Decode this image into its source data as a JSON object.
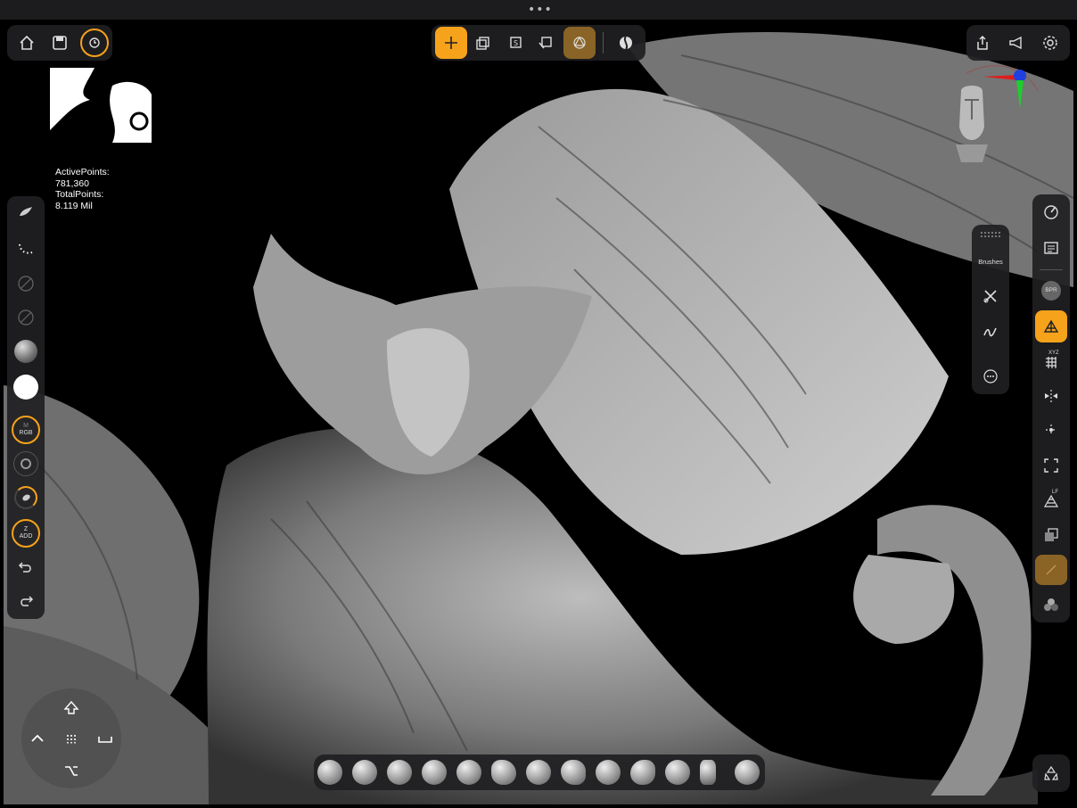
{
  "stats": {
    "active_label": "ActivePoints:",
    "active_value": "781,360",
    "total_label": "TotalPoints:",
    "total_value": "8.119 Mil"
  },
  "left_toolbar": {
    "rgb_label": "RGB",
    "zadd_top": "Z",
    "zadd_label": "ADD",
    "m_label": "M"
  },
  "brushes_panel": {
    "label": "Brushes"
  },
  "right_toolbar": {
    "bpr_label": "BPR",
    "xyz_label": "XYZ",
    "lf_label": "LF"
  },
  "colors": {
    "accent": "#f7a21b",
    "toolbar_bg": "#202022"
  },
  "icons": {
    "top_left": [
      "home-icon",
      "save-icon",
      "history-icon"
    ],
    "top_center": [
      "move-gizmo-icon",
      "subtool-icon",
      "solo-icon",
      "reset-icon",
      "dynamesh-icon",
      "matcap-icon"
    ],
    "top_right": [
      "share-icon",
      "announce-icon",
      "settings-icon"
    ]
  }
}
